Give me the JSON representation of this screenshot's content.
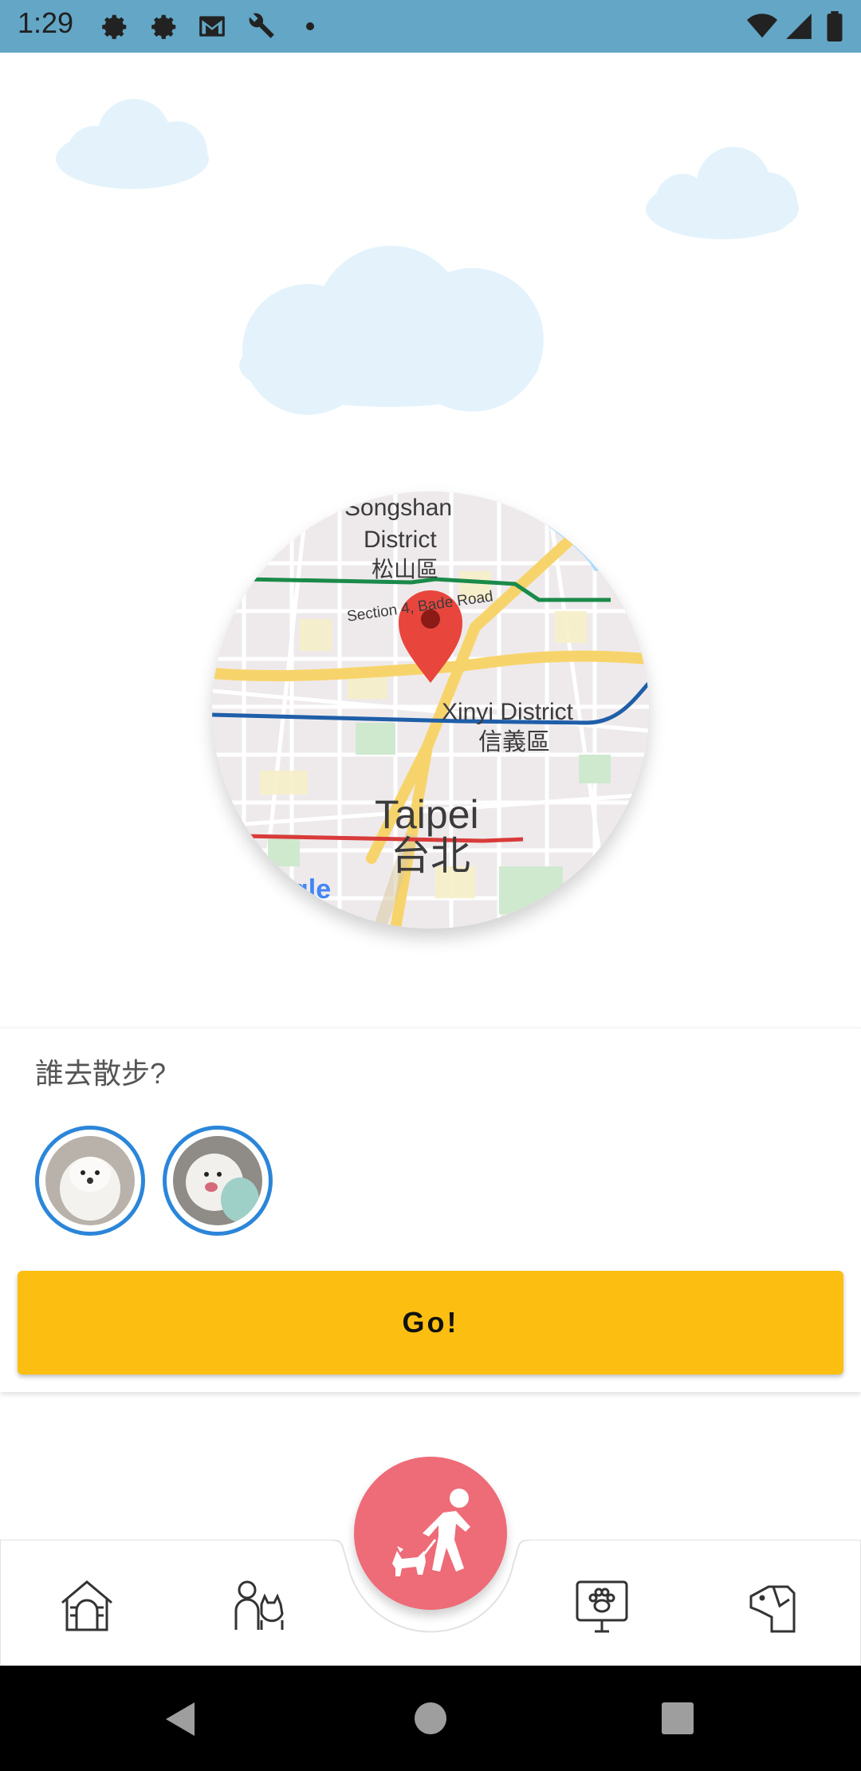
{
  "status_bar": {
    "time": "1:29",
    "left_icons": [
      "settings-icon",
      "settings-icon",
      "gmail-icon",
      "wrench-icon",
      "dot-icon"
    ],
    "right_icons": [
      "wifi-icon",
      "signal-icon",
      "battery-icon"
    ]
  },
  "map": {
    "labels": {
      "songshan_en": "Songshan",
      "district_en": "District",
      "songshan_zh": "松山區",
      "road": "Section 4, Bade Road",
      "xinyi_en": "Xinyi District",
      "xinyi_zh": "信義區",
      "taipei_en": "Taipei",
      "taipei_zh": "台北",
      "google": "gle"
    }
  },
  "walk_card": {
    "prompt": "誰去散步?",
    "pets": [
      {
        "name": "pet-avatar-1"
      },
      {
        "name": "pet-avatar-2"
      }
    ],
    "go_label": "Go!"
  },
  "bottom_nav": {
    "items": [
      "doghouse-icon",
      "owner-with-dog-icon",
      "walk-dog-icon",
      "paw-sign-icon",
      "dog-profile-icon"
    ]
  },
  "colors": {
    "status_bar": "#63a6c6",
    "accent_yellow": "#fcbf11",
    "fab_pink": "#ee6b78",
    "avatar_ring": "#2b86d9",
    "cloud": "#e4f3fb"
  }
}
